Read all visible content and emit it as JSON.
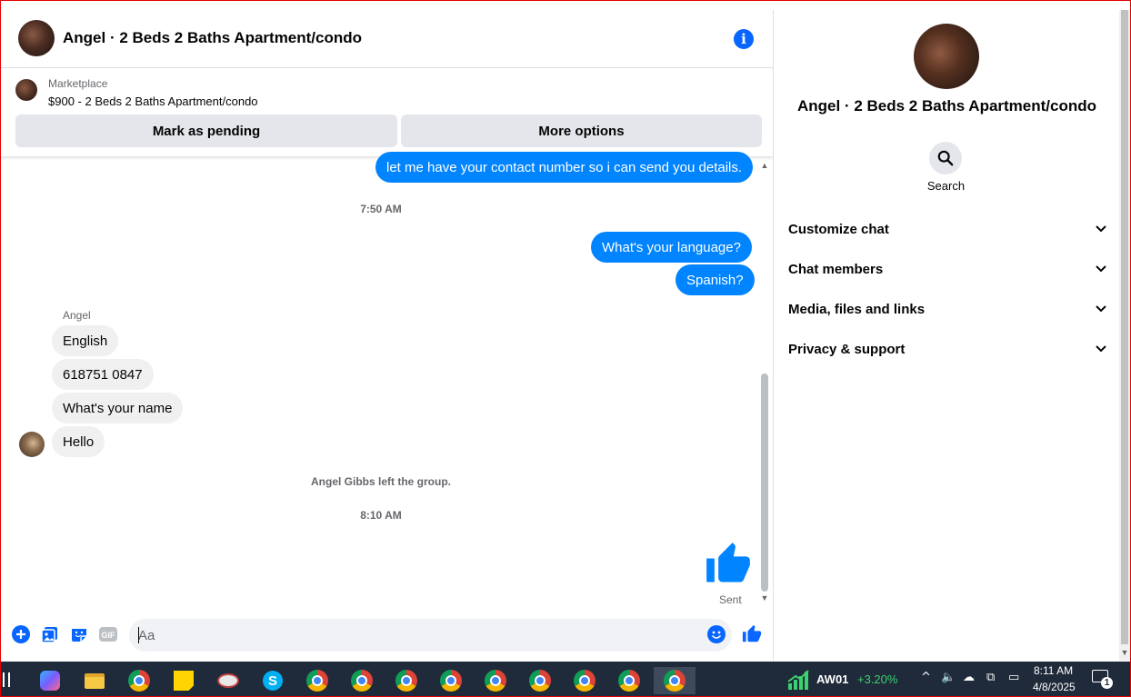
{
  "conversation": {
    "title": "Angel · 2 Beds 2 Baths Apartment/condo"
  },
  "marketplace": {
    "source": "Marketplace",
    "item": "$900 - 2 Beds 2 Baths Apartment/condo",
    "primary_action": "Mark as pending",
    "secondary_action": "More options"
  },
  "messages": {
    "out_contact": "let me have your contact number so i can send you details.",
    "stamp_1": "7:50 AM",
    "out_language": "What's your language?",
    "out_spanish": "Spanish?",
    "sender_name": "Angel",
    "in_english": "English",
    "in_number": "618751 0847",
    "in_name": "What's your name",
    "in_hello": "Hello",
    "system_left": "Angel Gibbs left the group.",
    "stamp_2": "8:10 AM",
    "sent_status": "Sent"
  },
  "composer": {
    "placeholder": "Aa",
    "gif_label": "GIF"
  },
  "info_panel": {
    "title": "Angel · 2 Beds 2 Baths Apartment/condo",
    "search_label": "Search",
    "sections": [
      "Customize chat",
      "Chat members",
      "Media, files and links",
      "Privacy & support"
    ]
  },
  "taskbar": {
    "stock_symbol": "AW01",
    "stock_change": "+3.20%",
    "time": "8:11 AM",
    "date": "4/8/2025",
    "notification_count": "1"
  },
  "colors": {
    "accent": "#0084ff",
    "brand_blue": "#0866ff",
    "incoming_bubble": "#f0f0f0",
    "taskbar": "#1f2a3a"
  }
}
